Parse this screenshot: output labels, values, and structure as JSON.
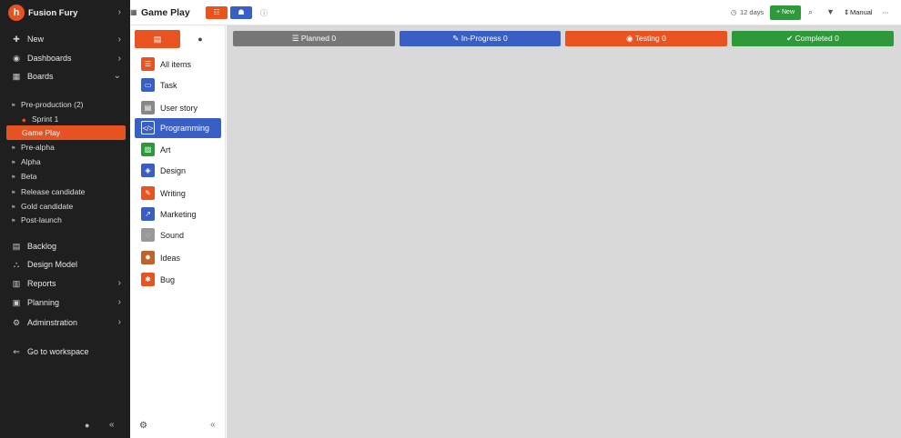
{
  "app": {
    "title": "Fusion Fury",
    "logo_letter": "h"
  },
  "sidebar": {
    "main_items": [
      {
        "label": "New",
        "icon": "plus-icon"
      },
      {
        "label": "Dashboards",
        "icon": "dashboard-icon"
      },
      {
        "label": "Boards",
        "icon": "boards-icon"
      }
    ],
    "boards": [
      {
        "label": "Pre-production (2)"
      },
      {
        "label": "Sprint 1"
      },
      {
        "label": "Game Play"
      },
      {
        "label": "Pre-alpha"
      },
      {
        "label": "Alpha"
      },
      {
        "label": "Beta"
      },
      {
        "label": "Release candidate"
      },
      {
        "label": "Gold candidate"
      },
      {
        "label": "Post-launch"
      }
    ],
    "lower_items": [
      {
        "label": "Backlog",
        "icon": "backlog-icon"
      },
      {
        "label": "Design Model",
        "icon": "design-model-icon"
      },
      {
        "label": "Reports",
        "icon": "reports-icon"
      },
      {
        "label": "Planning",
        "icon": "planning-icon"
      },
      {
        "label": "Adminstration",
        "icon": "gear-icon"
      }
    ],
    "workspace_label": "Go to workspace"
  },
  "topbar": {
    "title": "Game Play",
    "days": "12 days",
    "new_label": "+ New",
    "manual_label": "Manual"
  },
  "type_panel": {
    "items": [
      {
        "label": "All items",
        "color": "#e9531f"
      },
      {
        "label": "Task",
        "color": "#3a5fc4"
      },
      {
        "label": "User story",
        "color": "#888888"
      },
      {
        "label": "Programming",
        "color": "#3a5fc4"
      },
      {
        "label": "Art",
        "color": "#2d9a3a"
      },
      {
        "label": "Design",
        "color": "#3a5fc4"
      },
      {
        "label": "Writing",
        "color": "#e9531f"
      },
      {
        "label": "Marketing",
        "color": "#3a5fc4"
      },
      {
        "label": "Sound",
        "color": "#999999"
      },
      {
        "label": "Ideas",
        "color": "#c0622a"
      },
      {
        "label": "Bug",
        "color": "#e9531f"
      }
    ],
    "active_index": 3
  },
  "board": {
    "columns": [
      {
        "label": "Planned 0",
        "color": "#777777"
      },
      {
        "label": "In-Progress 0",
        "color": "#3a5fc4"
      },
      {
        "label": "Testing 0",
        "color": "#e9531f"
      },
      {
        "label": "Completed 0",
        "color": "#2d9a3a"
      }
    ]
  }
}
